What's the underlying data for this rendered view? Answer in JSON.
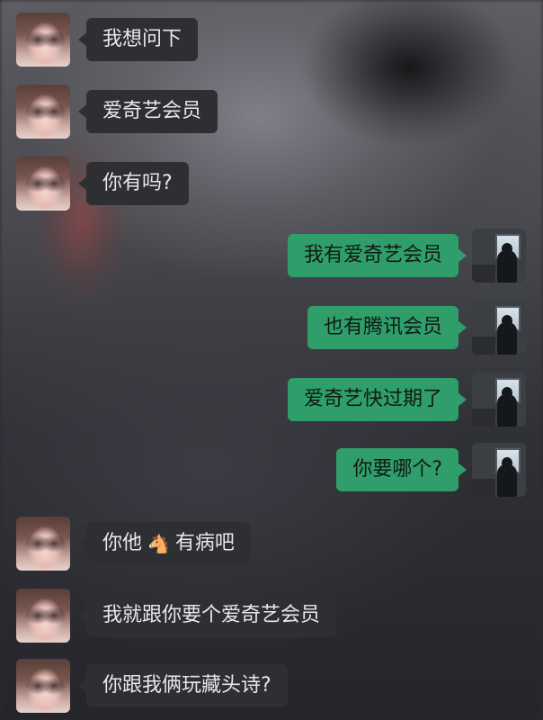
{
  "messages": [
    {
      "side": "left",
      "text": "我想问下"
    },
    {
      "side": "left",
      "text": "爱奇艺会员"
    },
    {
      "side": "left",
      "text": "你有吗?"
    },
    {
      "side": "right",
      "text": "我有爱奇艺会员"
    },
    {
      "side": "right",
      "text": "也有腾讯会员"
    },
    {
      "side": "right",
      "text": "爱奇艺快过期了"
    },
    {
      "side": "right",
      "text": "你要哪个?"
    },
    {
      "side": "left",
      "text_before": "你他",
      "emoji": "🐴",
      "emoji_name": "horse-face-icon",
      "text_after": "有病吧"
    },
    {
      "side": "left",
      "text": "我就跟你要个爱奇艺会员"
    },
    {
      "side": "left",
      "text": "你跟我俩玩藏头诗?"
    }
  ],
  "colors": {
    "sent_bubble": "#2f9e6b",
    "received_bubble": "#2e2f33",
    "received_text": "#e8e8ea",
    "sent_text": "#101a14"
  }
}
